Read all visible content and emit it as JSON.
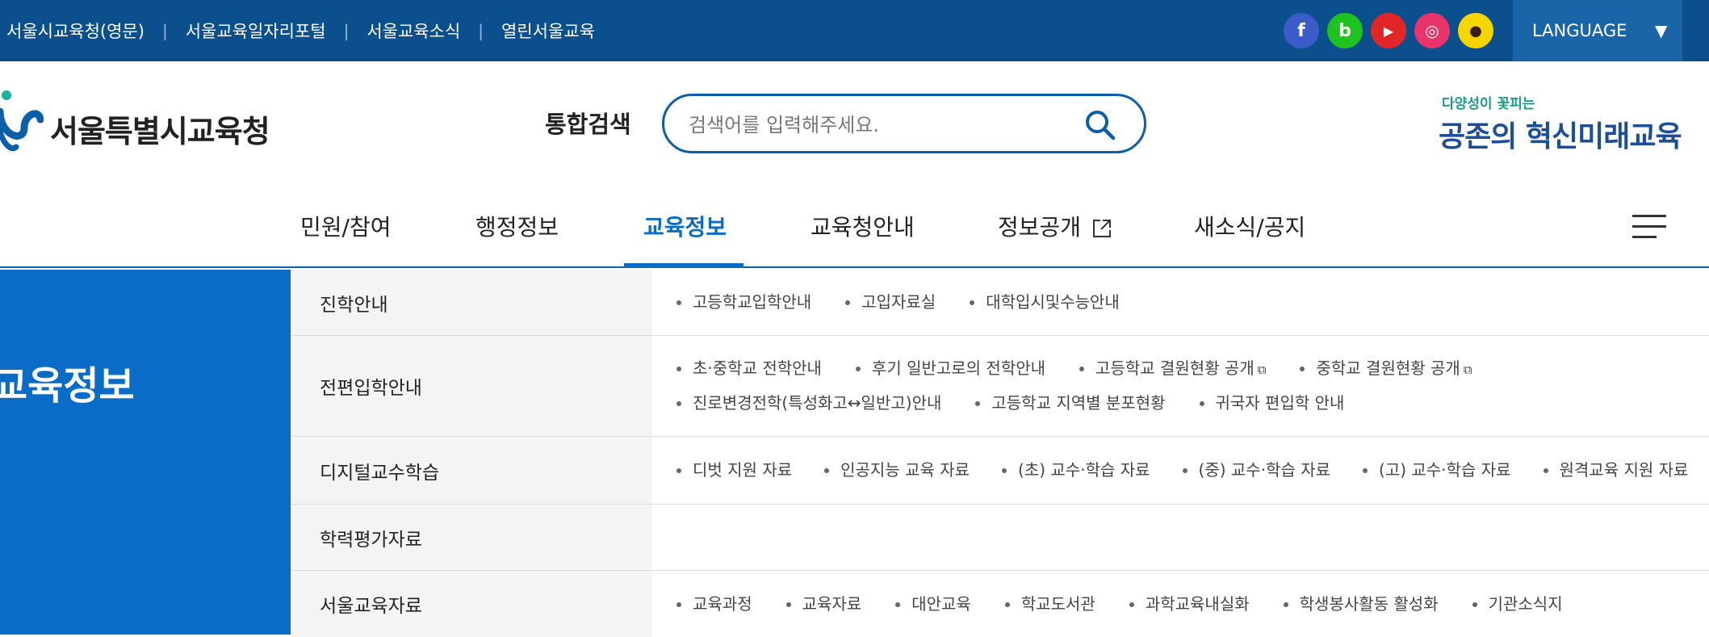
{
  "top_links": [
    "서울시교육청(영문)",
    "서울교육일자리포털",
    "서울교육소식",
    "열린서울교육"
  ],
  "social": [
    {
      "name": "facebook",
      "glyph": "f"
    },
    {
      "name": "blog",
      "glyph": "b"
    },
    {
      "name": "youtube",
      "glyph": "▶"
    },
    {
      "name": "instagram",
      "glyph": "◎"
    },
    {
      "name": "kakao",
      "glyph": "●"
    }
  ],
  "language_label": "LANGUAGE",
  "site_name": "서울특별시교육청",
  "search": {
    "label": "통합검색",
    "placeholder": "검색어를 입력해주세요."
  },
  "slogan": {
    "small": "다양성이 꽃피는",
    "big": "공존의 혁신미래교육"
  },
  "nav": [
    "민원/참여",
    "행정정보",
    "교육정보",
    "교육청안내",
    "정보공개",
    "새소식/공지"
  ],
  "nav_active": "교육정보",
  "side_title": "교육정보",
  "menu": [
    {
      "category": "진학안내",
      "links": [
        "고등학교입학안내",
        "고입자료실",
        "대학입시및수능안내"
      ]
    },
    {
      "category": "전편입학안내",
      "links": [
        "초·중학교 전학안내",
        "후기 일반고로의 전학안내",
        "고등학교 결원현황 공개",
        "중학교 결원현황 공개",
        "진로변경전학(특성화고↔일반고)안내",
        "고등학교 지역별 분포현황",
        "귀국자 편입학 안내"
      ]
    },
    {
      "category": "디지털교수학습",
      "links": [
        "디벗 지원 자료",
        "인공지능 교육 자료",
        "(초) 교수·학습 자료",
        "(중) 교수·학습 자료",
        "(고) 교수·학습 자료",
        "원격교육 지원 자료"
      ]
    },
    {
      "category": "학력평가자료",
      "links": []
    },
    {
      "category": "서울교육자료",
      "links": [
        "교육과정",
        "교육자료",
        "대안교육",
        "학교도서관",
        "과학교육내실화",
        "학생봉사활동 활성화",
        "기관소식지"
      ]
    }
  ],
  "colors": {
    "topbar": "#0b4f8c",
    "accent": "#0b6cc7",
    "language_bg": "#1a64a8",
    "side_panel": "#0b6cc7"
  }
}
